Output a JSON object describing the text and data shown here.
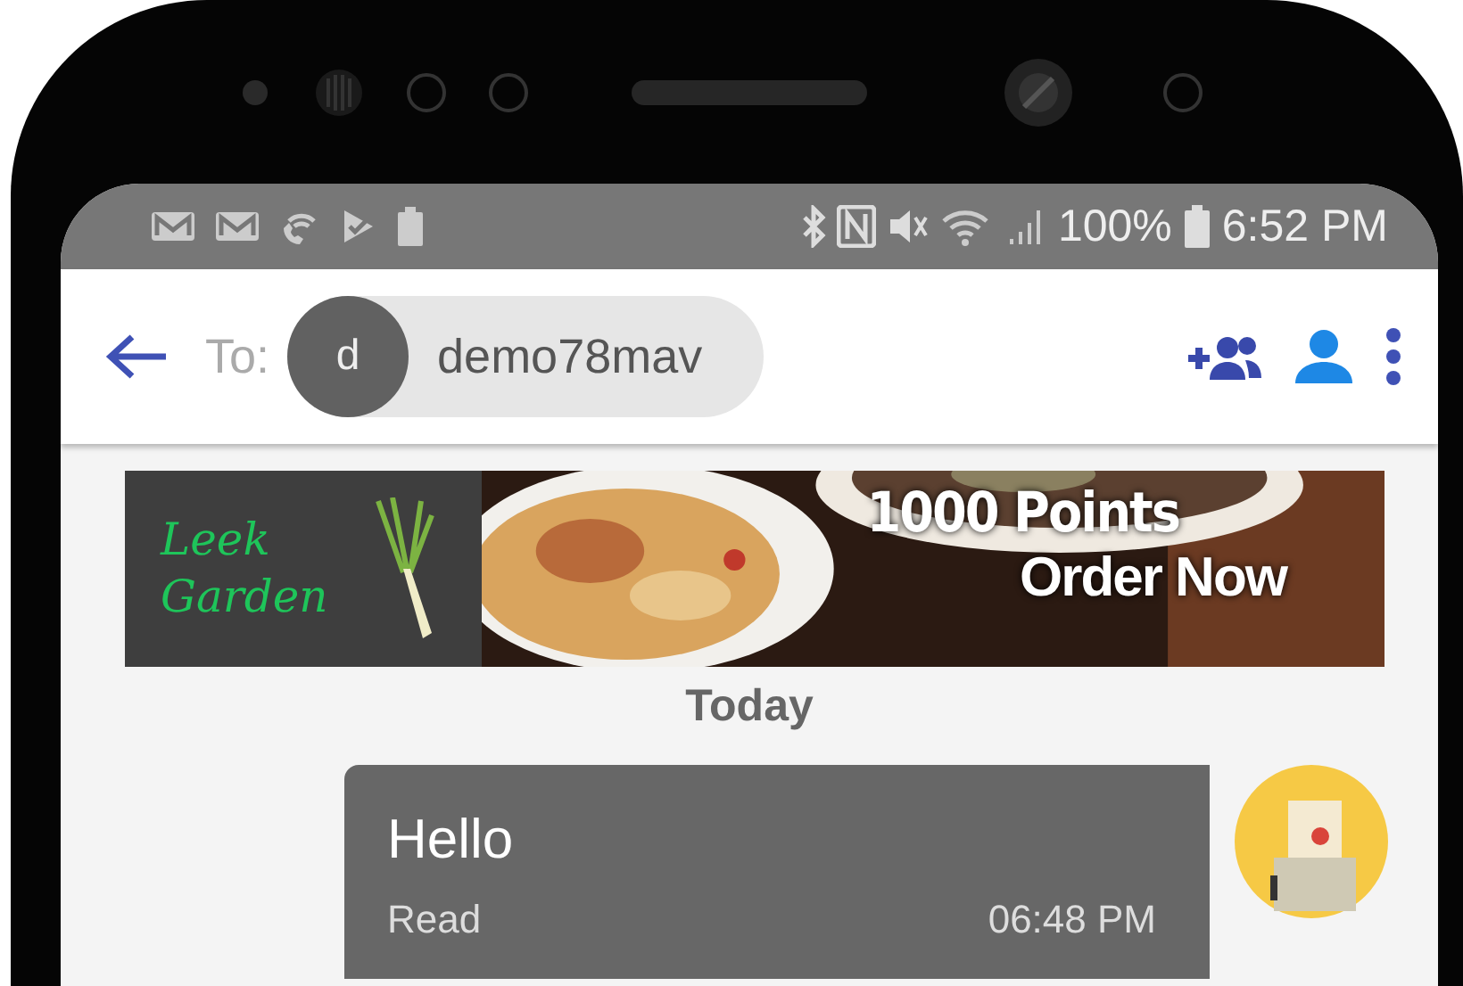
{
  "status_bar": {
    "battery": "100%",
    "time": "6:52 PM"
  },
  "header": {
    "to_label": "To:",
    "recipient": {
      "initial": "d",
      "name": "demo78mav"
    }
  },
  "banner": {
    "kind": "picture",
    "logo": [
      "Leek",
      "Garden"
    ],
    "headline": "1000 Points",
    "cta": "Order Now"
  },
  "date_divider": "Today",
  "messages": [
    {
      "text": "Hello",
      "status": "Read",
      "time": "06:48 PM"
    }
  ]
}
